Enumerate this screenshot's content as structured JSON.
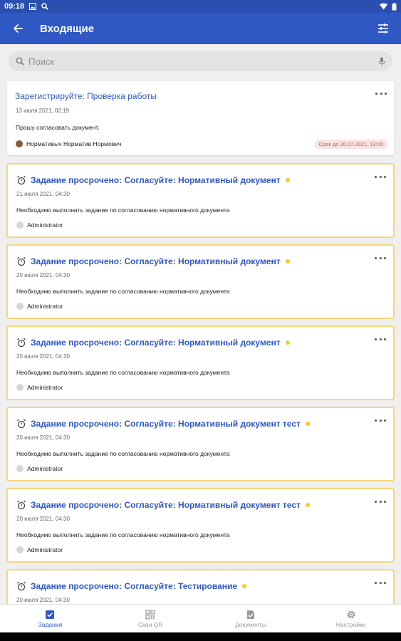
{
  "status_bar": {
    "time": "09:18"
  },
  "header": {
    "title": "Входящие"
  },
  "search": {
    "placeholder": "Поиск"
  },
  "cards": [
    {
      "title": "Зарегистрируйте: Проверка работы",
      "date": "13 июля 2021, 02:19",
      "description": "Прошу согласовать документ.",
      "author": "Нормативыч Норматив Нормович",
      "deadline": "Срок до 26.07.2021, 13:00"
    },
    {
      "title": "Задание просрочено: Согласуйте: Нормативный документ",
      "date": "21 июля 2021, 04:30",
      "description": "Необходимо выполнить задание по согласованию нормативного документа",
      "author": "Administrator"
    },
    {
      "title": "Задание просрочено: Согласуйте: Нормативный документ",
      "date": "20 июля 2021, 04:30",
      "description": "Необходимо выполнить задание по согласованию нормативного документа",
      "author": "Administrator"
    },
    {
      "title": "Задание просрочено: Согласуйте: Нормативный документ",
      "date": "20 июля 2021, 04:30",
      "description": "Необходимо выполнить задание по согласованию нормативного документа",
      "author": "Administrator"
    },
    {
      "title": "Задание просрочено: Согласуйте: Нормативный документ тест",
      "date": "20 июля 2021, 04:30",
      "description": "Необходимо выполнить задание по согласованию нормативного документа",
      "author": "Administrator"
    },
    {
      "title": "Задание просрочено: Согласуйте: Нормативный документ тест",
      "date": "20 июля 2021, 04:30",
      "description": "Необходимо выполнить задание по согласованию нормативного документа",
      "author": "Administrator"
    },
    {
      "title": "Задание просрочено: Согласуйте: Тестирование",
      "date": "20 июля 2021, 04:30"
    }
  ],
  "bottom_nav": {
    "items": [
      {
        "label": "Задания",
        "icon": "tasks-icon",
        "active": true
      },
      {
        "label": "Скан QR",
        "icon": "qr-icon"
      },
      {
        "label": "Документы",
        "icon": "documents-icon"
      },
      {
        "label": "Настройки",
        "icon": "settings-icon"
      }
    ]
  },
  "colors": {
    "app_bar": "#2f58c4",
    "status_bar": "#2a4fb0",
    "link_title": "#2f58c4",
    "overdue_border": "#f5d77b",
    "overdue_dot": "#f2cc1f",
    "deadline_bg": "#fbe3e3",
    "deadline_text": "#b86060"
  }
}
